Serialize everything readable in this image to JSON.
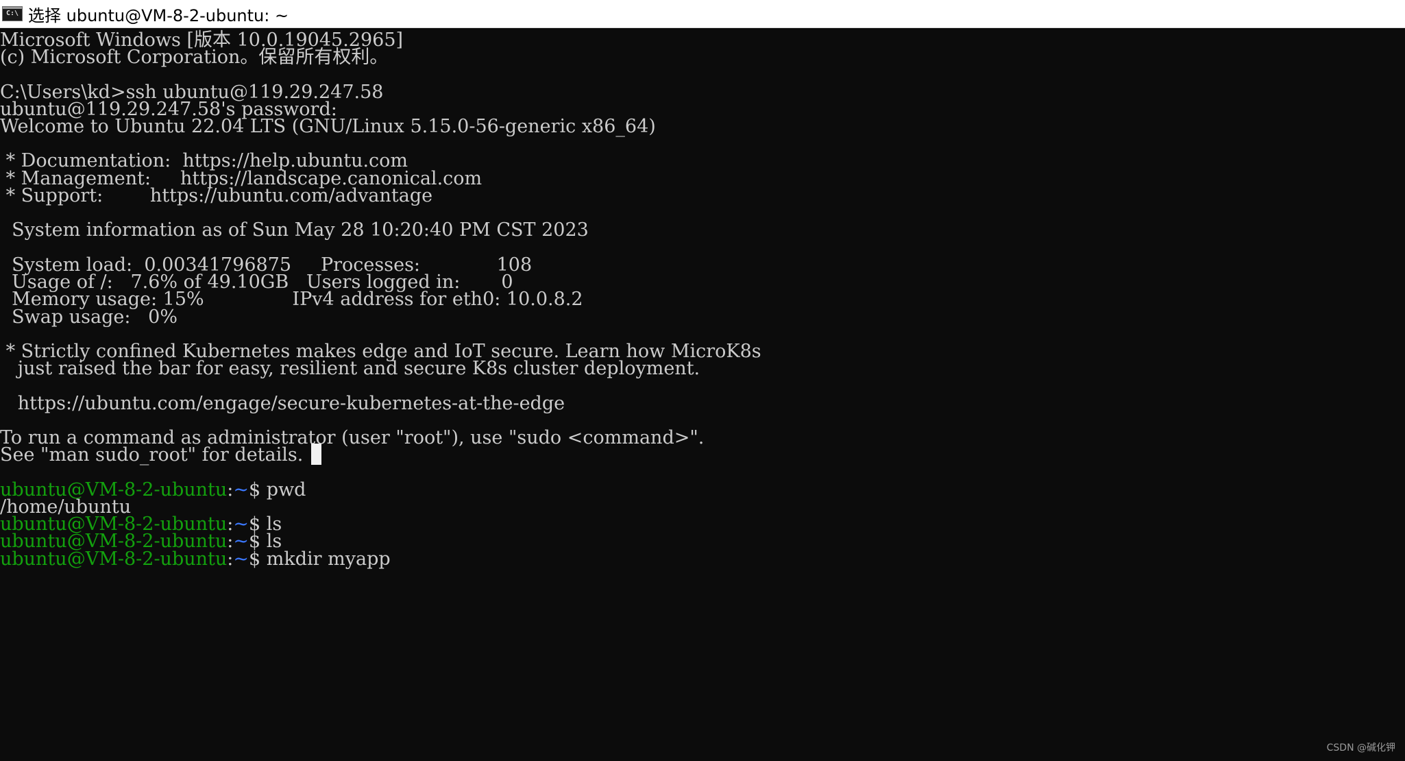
{
  "window": {
    "title": "选择 ubuntu@VM-8-2-ubuntu: ~",
    "icon": "console-icon",
    "icon_label": "C:\\"
  },
  "colors": {
    "background": "#0c0c0c",
    "foreground": "#cccccc",
    "prompt_user": "#13a10e",
    "prompt_path": "#3b78ff",
    "cursor": "#f2f2f2"
  },
  "terminal": {
    "lines": [
      "Microsoft Windows [版本 10.0.19045.2965]",
      "(c) Microsoft Corporation。保留所有权利。",
      "",
      "C:\\Users\\kd>ssh ubuntu@119.29.247.58",
      "ubuntu@119.29.247.58's password:",
      "Welcome to Ubuntu 22.04 LTS (GNU/Linux 5.15.0-56-generic x86_64)",
      "",
      " * Documentation:  https://help.ubuntu.com",
      " * Management:     https://landscape.canonical.com",
      " * Support:        https://ubuntu.com/advantage",
      "",
      "  System information as of Sun May 28 10:20:40 PM CST 2023",
      "",
      "  System load:  0.00341796875     Processes:             108",
      "  Usage of /:   7.6% of 49.10GB   Users logged in:       0",
      "  Memory usage: 15%               IPv4 address for eth0: 10.0.8.2",
      "  Swap usage:   0%",
      "",
      " * Strictly confined Kubernetes makes edge and IoT secure. Learn how MicroK8s",
      "   just raised the bar for easy, resilient and secure K8s cluster deployment.",
      "",
      "   https://ubuntu.com/engage/secure-kubernetes-at-the-edge",
      "",
      "To run a command as administrator (user \"root\"), use \"sudo <command>\".",
      "See \"man sudo_root\" for details."
    ],
    "prompt": {
      "user_host": "ubuntu@VM-8-2-ubuntu",
      "separator": ":",
      "path": "~",
      "symbol": "$"
    },
    "session": [
      {
        "command": "pwd",
        "output": "/home/ubuntu"
      },
      {
        "command": "ls"
      },
      {
        "command": "ls"
      },
      {
        "command": "mkdir myapp"
      }
    ]
  },
  "watermark": "CSDN @碱化钾"
}
